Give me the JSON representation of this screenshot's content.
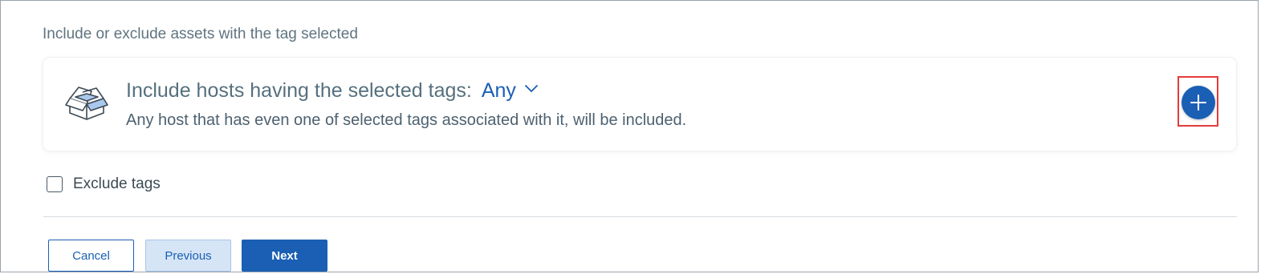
{
  "section": {
    "label": "Include or exclude assets with the tag selected"
  },
  "include_card": {
    "icon": "open-box-icon",
    "title": "Include hosts having the selected tags:",
    "match_mode": {
      "selected": "Any",
      "icon": "chevron-down-icon"
    },
    "description": "Any host that has even one of selected tags associated with it, will be included.",
    "add_button": {
      "icon": "plus-icon",
      "highlighted": true
    }
  },
  "exclude": {
    "label": "Exclude tags",
    "checked": false
  },
  "footer": {
    "cancel_label": "Cancel",
    "previous_label": "Previous",
    "next_label": "Next"
  },
  "colors": {
    "accent": "#1a5fb4",
    "highlight": "#e53b3b",
    "secondary_button_bg": "#d6e5f6"
  }
}
